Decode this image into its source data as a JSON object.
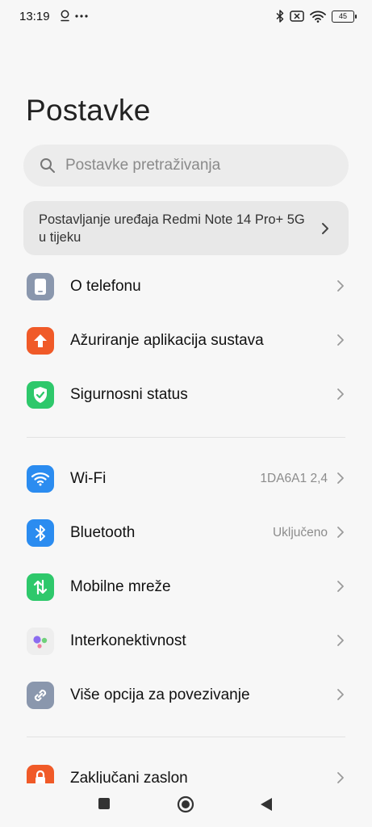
{
  "status": {
    "time": "13:19",
    "battery": "45",
    "icons": [
      "location-icon",
      "more-icon",
      "bluetooth-icon",
      "no-sim-icon",
      "wifi-icon",
      "battery-icon"
    ]
  },
  "page": {
    "title": "Postavke"
  },
  "search": {
    "placeholder": "Postavke pretraživanja"
  },
  "setup": {
    "text": "Postavljanje uređaja Redmi Note 14 Pro+ 5G u tijeku"
  },
  "items": [
    {
      "label": "O telefonu",
      "value": "",
      "icon": "phone-icon",
      "color": "#8a97ad"
    },
    {
      "label": "Ažuriranje aplikacija sustava",
      "value": "",
      "icon": "update-arrow-icon",
      "color": "#f05a28"
    },
    {
      "label": "Sigurnosni status",
      "value": "",
      "icon": "shield-check-icon",
      "color": "#2ec86b"
    },
    {
      "label": "Wi-Fi",
      "value": "1DA6A1 2,4",
      "icon": "wifi-icon",
      "color": "#2b8cf0"
    },
    {
      "label": "Bluetooth",
      "value": "Uključeno",
      "icon": "bluetooth-icon",
      "color": "#2b8cf0"
    },
    {
      "label": "Mobilne mreže",
      "value": "",
      "icon": "mobile-data-icon",
      "color": "#2ec86b"
    },
    {
      "label": "Interkonektivnost",
      "value": "",
      "icon": "interconnect-dots-icon",
      "color": "#eeeeee"
    },
    {
      "label": "Više opcija za povezivanje",
      "value": "",
      "icon": "link-icon",
      "color": "#8a97ad"
    },
    {
      "label": "Zaključani zaslon",
      "value": "",
      "icon": "lock-icon",
      "color": "#f05a28"
    }
  ],
  "navbar": {
    "buttons": [
      "recents-button",
      "home-button",
      "back-button"
    ]
  }
}
